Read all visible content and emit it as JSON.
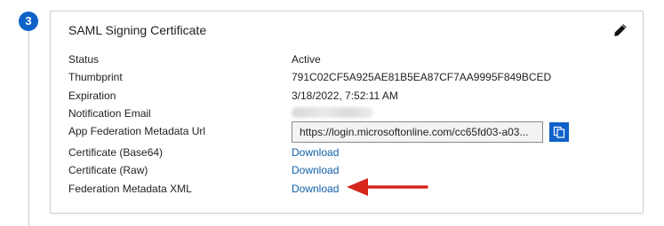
{
  "step": {
    "number": "3"
  },
  "card": {
    "title": "SAML Signing Certificate",
    "edit_icon": "pencil-icon"
  },
  "rows": [
    {
      "label": "Status",
      "value": "Active"
    },
    {
      "label": "Thumbprint",
      "value": "791C02CF5A925AE81B5EA87CF7AA9995F849BCED"
    },
    {
      "label": "Expiration",
      "value": "3/18/2022, 7:52:11 AM"
    },
    {
      "label": "Notification Email",
      "value_hidden": true
    },
    {
      "label": "App Federation Metadata Url",
      "value": "https://login.microsoftonline.com/cc65fd03-a03...",
      "copy_icon": "copy-icon"
    },
    {
      "label": "Certificate (Base64)",
      "link": "Download"
    },
    {
      "label": "Certificate (Raw)",
      "link": "Download"
    },
    {
      "label": "Federation Metadata XML",
      "link": "Download"
    }
  ],
  "colors": {
    "accent": "#0f62c8",
    "link": "#0f5fa8",
    "arrow": "#d6261c"
  }
}
